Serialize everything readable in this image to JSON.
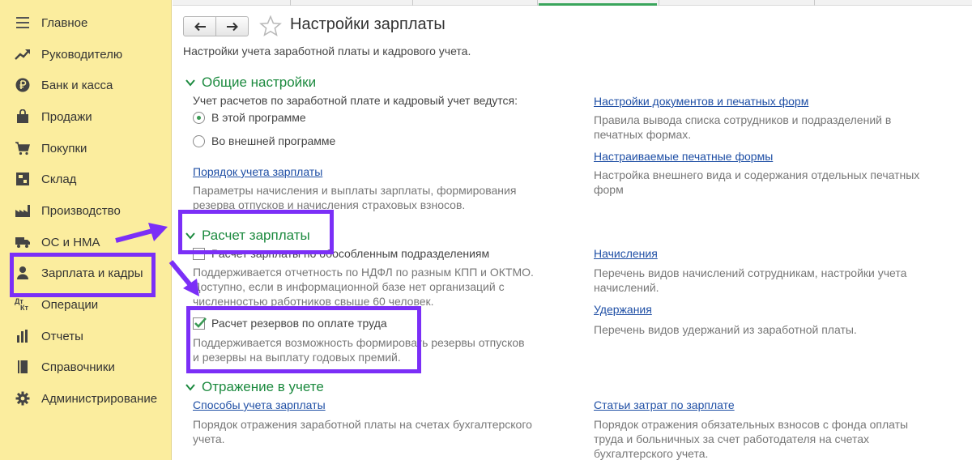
{
  "sidebar": {
    "items": [
      {
        "label": "Главное",
        "icon": "menu-icon"
      },
      {
        "label": "Руководителю",
        "icon": "trend-chart-icon"
      },
      {
        "label": "Банк и касса",
        "icon": "ruble-coin-icon"
      },
      {
        "label": "Продажи",
        "icon": "shopping-bag-icon"
      },
      {
        "label": "Покупки",
        "icon": "cart-icon"
      },
      {
        "label": "Склад",
        "icon": "warehouse-icon"
      },
      {
        "label": "Производство",
        "icon": "factory-icon"
      },
      {
        "label": "ОС и НМА",
        "icon": "truck-icon"
      },
      {
        "label": "Зарплата и кадры",
        "icon": "person-icon"
      },
      {
        "label": "Операции",
        "icon": "dt-kt-icon"
      },
      {
        "label": "Отчеты",
        "icon": "bar-chart-icon"
      },
      {
        "label": "Справочники",
        "icon": "book-icon"
      },
      {
        "label": "Администрирование",
        "icon": "gear-icon"
      }
    ],
    "dt_kt_glyph": {
      "top": "Дт",
      "bottom": "Кт"
    }
  },
  "header": {
    "title": "Настройки зарплаты",
    "subtitle": "Настройки учета заработной платы и кадрового учета."
  },
  "general": {
    "title": "Общие настройки",
    "prompt": "Учет расчетов по заработной плате и кадровый учет ведутся:",
    "options": [
      "В этой программе",
      "Во внешней программе"
    ],
    "selected": "В этой программе",
    "order_link": "Порядок учета зарплаты",
    "order_desc": [
      "Параметры начисления и выплаты зарплаты, формирования",
      "резерва отпусков и начисления страховых взносов."
    ],
    "docs_link": "Настройки документов и печатных форм",
    "docs_desc": [
      "Правила вывода списка сотрудников и подразделений в",
      "печатных формах."
    ],
    "print_link": "Настраиваемые печатные формы",
    "print_desc": [
      "Настройка внешнего вида и содержания отдельных печатных",
      "форм"
    ]
  },
  "payroll": {
    "title": "Расчет зарплаты",
    "separate_check_label": "Расчет зарплаты по обособленным подразделениям",
    "separate_checked": false,
    "separate_desc": [
      "Поддерживается отчетность по НДФЛ по разным КПП и ОКТМО.",
      "Доступно, если в информационной базе нет организаций с",
      "численностью работников свыше 60 человек."
    ],
    "reserves_check_label": "Расчет резервов по оплате труда",
    "reserves_checked": true,
    "reserves_desc": [
      "Поддерживается возможность формировать резервы отпусков",
      "и резервы на выплату годовых премий."
    ],
    "accruals_link": "Начисления",
    "accruals_desc": [
      "Перечень видов начислений сотрудникам, настройки учета",
      "начислений."
    ],
    "deductions_link": "Удержания",
    "deductions_desc": "Перечень видов удержаний из заработной платы."
  },
  "accounting": {
    "title": "Отражение в учете",
    "methods_link": "Способы учета зарплаты",
    "methods_desc": [
      "Порядок отражения заработной платы на счетах бухгалтерского",
      "учета."
    ],
    "costs_link": "Статьи затрат по зарплате",
    "costs_desc": [
      "Порядок отражения обязательных взносов с фонда оплаты",
      "труда и больничных за счет работодателя на счетах",
      "бухгалтерского учета."
    ]
  },
  "colors": {
    "sidebar_bg": "#fbed9e",
    "section_green": "#1c8a3f",
    "link_blue": "#1f4fa5",
    "annotation_purple": "#7b2ff7",
    "checkmark_green": "#3a9a54"
  }
}
